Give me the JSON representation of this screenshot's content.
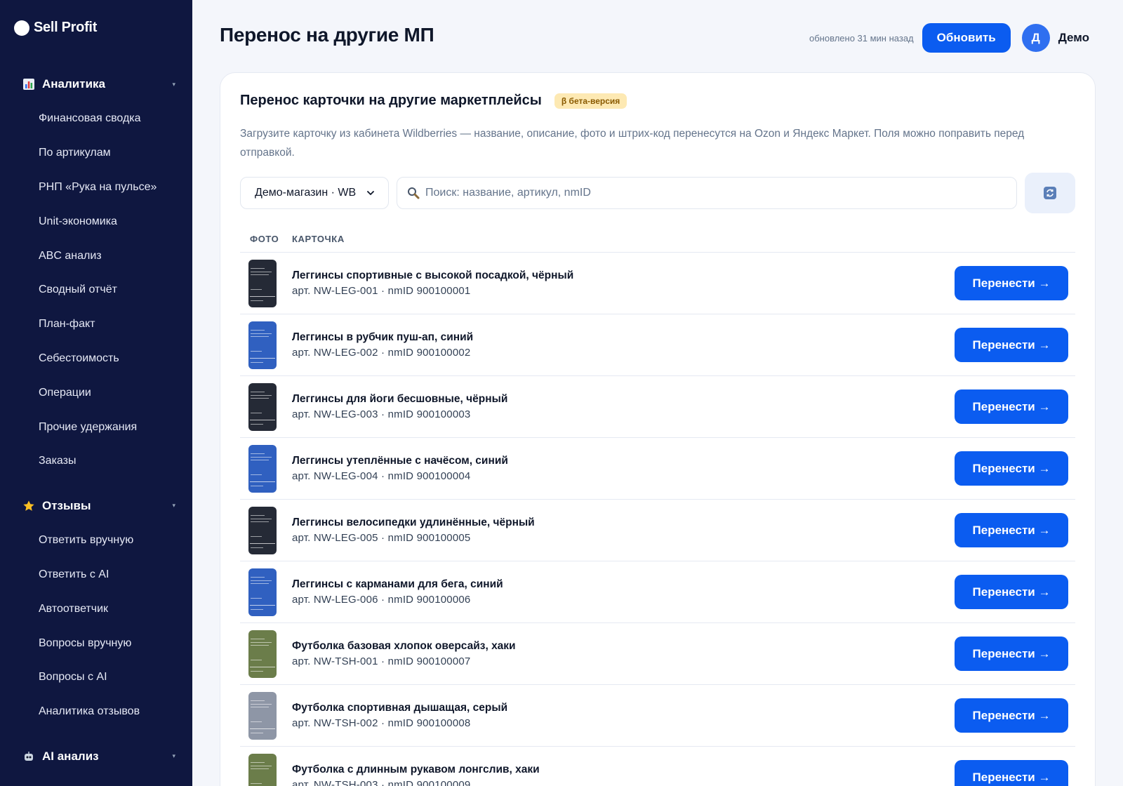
{
  "app": {
    "logo_text": "Sell Profit"
  },
  "sidebar": {
    "sections": [
      {
        "label": "Аналитика",
        "icon": "bar-chart-icon",
        "items": [
          "Финансовая сводка",
          "По артикулам",
          "РНП «Рука на пульсе»",
          "Unit-экономика",
          "ABC анализ",
          "Сводный отчёт",
          "План-факт",
          "Себестоимость",
          "Операции",
          "Прочие удержания",
          "Заказы"
        ]
      },
      {
        "label": "Отзывы",
        "icon": "star-icon",
        "items": [
          "Ответить вручную",
          "Ответить с AI",
          "Автоответчик",
          "Вопросы вручную",
          "Вопросы с AI",
          "Аналитика отзывов"
        ]
      },
      {
        "label": "AI анализ",
        "icon": "robot-icon",
        "items": []
      }
    ]
  },
  "header": {
    "title": "Перенос на другие МП",
    "updated": "обновлено 31 мин назад",
    "refresh_label": "Обновить",
    "avatar_letter": "Д",
    "user_name": "Демо"
  },
  "card": {
    "title": "Перенос карточки на другие маркетплейсы",
    "badge": "β бета-версия",
    "description": "Загрузите карточку из кабинета Wildberries — название, описание, фото и штрих-код перенесутся на Ozon и Яндекс Маркет. Поля можно поправить перед отправкой.",
    "store_select": "Демо-магазин · WB",
    "search_placeholder": "Поиск: название, артикул, nmID",
    "columns": {
      "photo": "ФОТО",
      "card": "КАРТОЧКА"
    },
    "move_label": "Перенести →",
    "rows": [
      {
        "name": "Леггинсы спортивные с высокой посадкой, чёрный",
        "meta": "арт. NW-LEG-001 · nmID 900100001",
        "color": "#252a36"
      },
      {
        "name": "Леггинсы в рубчик пуш-ап, синий",
        "meta": "арт. NW-LEG-002 · nmID 900100002",
        "color": "#3060c0"
      },
      {
        "name": "Леггинсы для йоги бесшовные, чёрный",
        "meta": "арт. NW-LEG-003 · nmID 900100003",
        "color": "#252a36"
      },
      {
        "name": "Леггинсы утеплённые с начёсом, синий",
        "meta": "арт. NW-LEG-004 · nmID 900100004",
        "color": "#3060c0"
      },
      {
        "name": "Леггинсы велосипедки удлинённые, чёрный",
        "meta": "арт. NW-LEG-005 · nmID 900100005",
        "color": "#252a36"
      },
      {
        "name": "Леггинсы с карманами для бега, синий",
        "meta": "арт. NW-LEG-006 · nmID 900100006",
        "color": "#3060c0"
      },
      {
        "name": "Футболка базовая хлопок оверсайз, хаки",
        "meta": "арт. NW-TSH-001 · nmID 900100007",
        "color": "#6b7d4a"
      },
      {
        "name": "Футболка спортивная дышащая, серый",
        "meta": "арт. NW-TSH-002 · nmID 900100008",
        "color": "#8e96a6"
      },
      {
        "name": "Футболка с длинным рукавом лонгслив, хаки",
        "meta": "арт. NW-TSH-003 · nmID 900100009",
        "color": "#6b7d4a"
      }
    ]
  },
  "colors": {
    "sidebar_bg": "#0f1740",
    "accent": "#0b5cf0",
    "beta_bg": "#fde9b3"
  }
}
